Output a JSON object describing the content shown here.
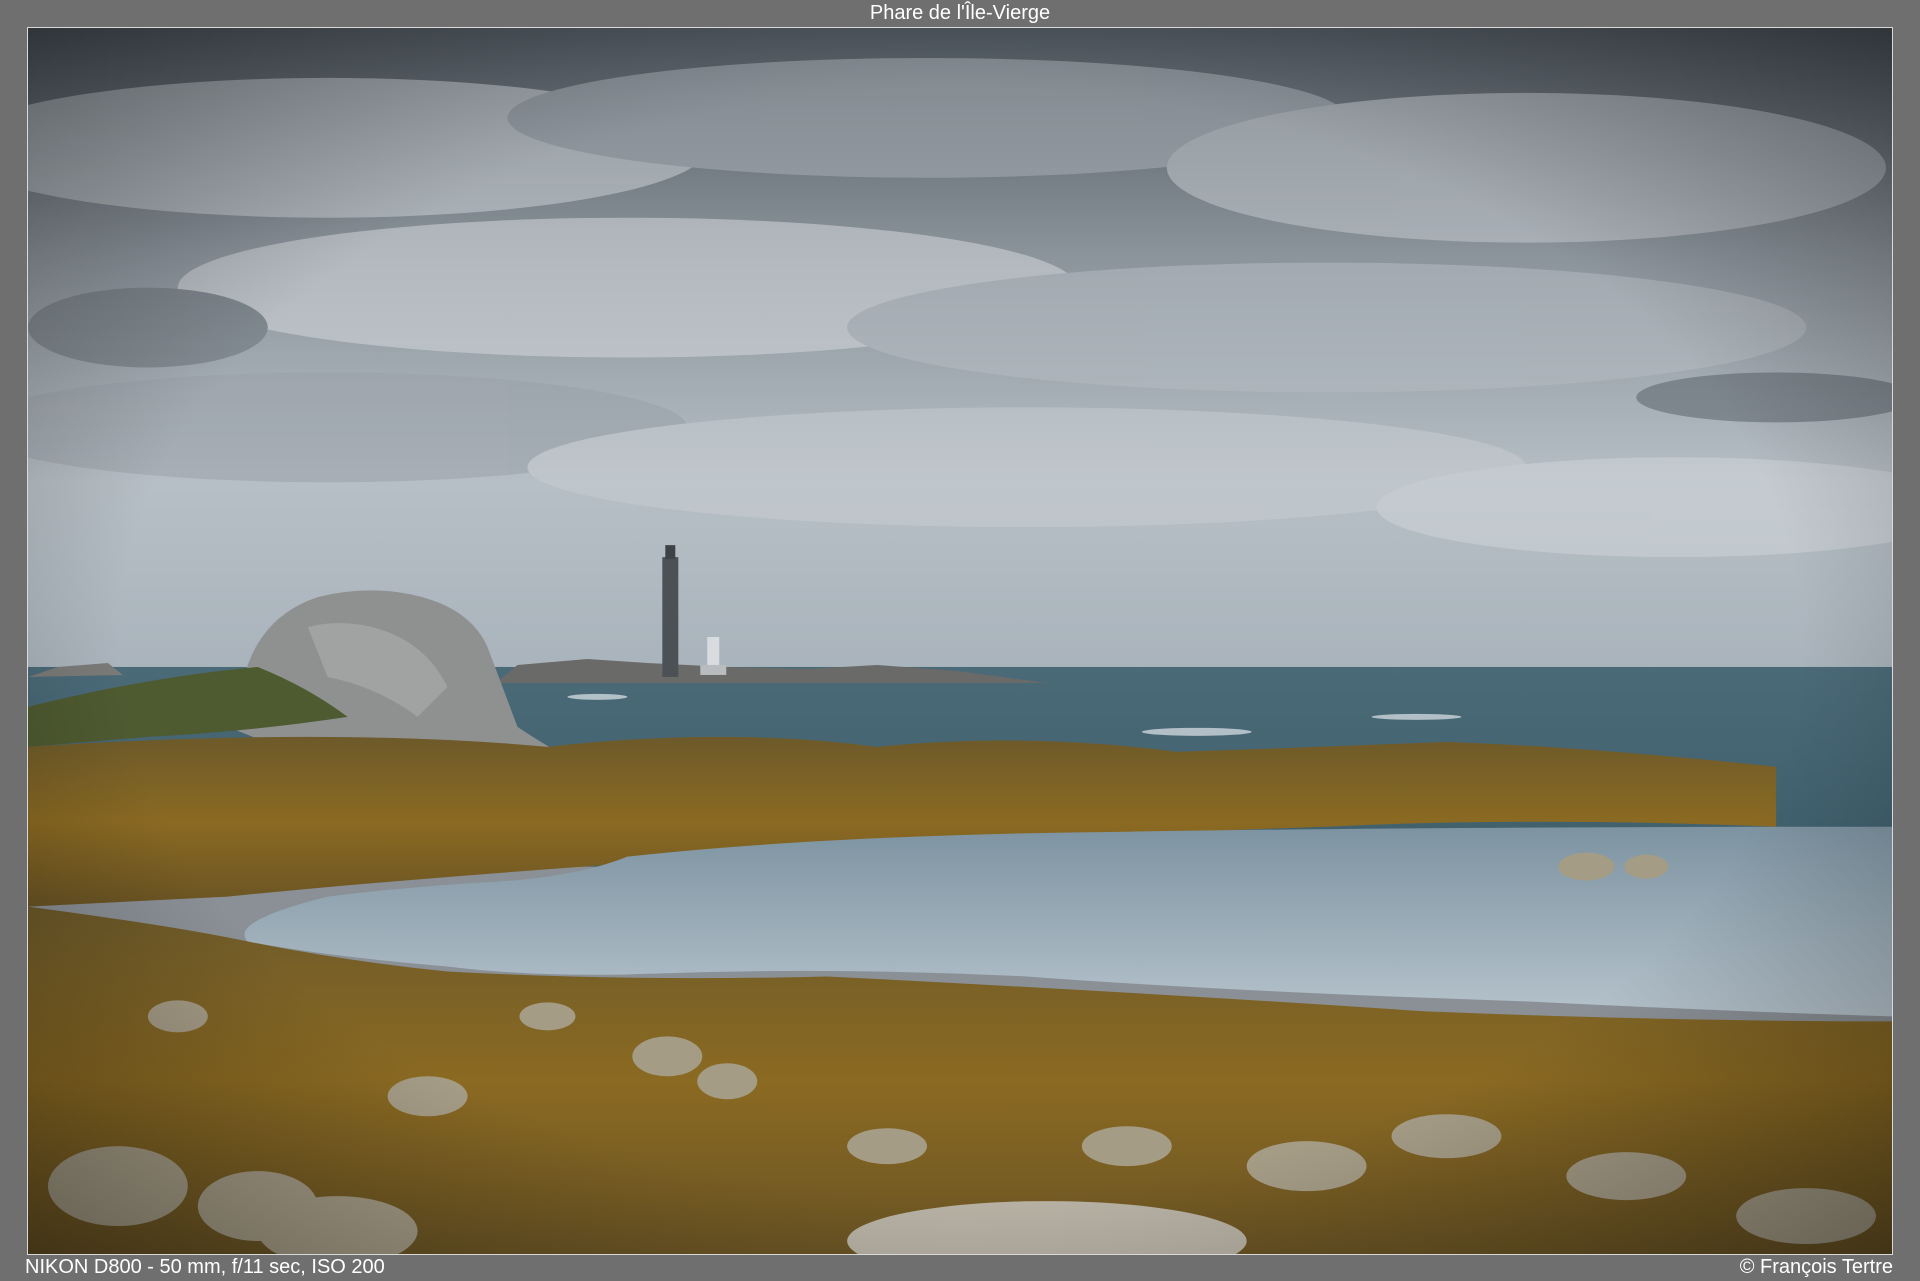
{
  "title": "Phare de l'Île-Vierge",
  "exif": "NIKON D800 - 50 mm, f/11 sec, ISO 200",
  "copyright": "© François Tertre",
  "photo": {
    "scene": "coastal-landscape",
    "colors": {
      "sky_top": "#5e666f",
      "sky_mid": "#b4bcc3",
      "sea": "#4f6f7c",
      "seaweed": "#8a6a24",
      "rock": "#8e8574",
      "pool": "#aab9c4"
    }
  }
}
